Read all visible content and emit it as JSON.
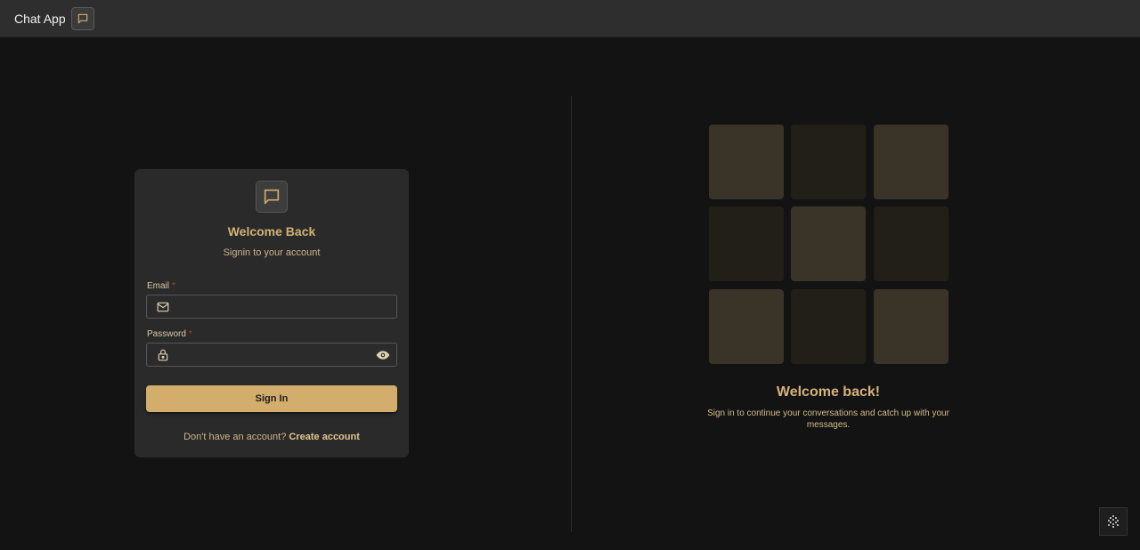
{
  "header": {
    "app_title": "Chat App",
    "icon": "chat-bubble-icon"
  },
  "login": {
    "title": "Welcome Back",
    "subtitle": "Signin to your account",
    "email_label": "Email",
    "email_value": "",
    "email_required": "*",
    "password_label": "Password",
    "password_value": "",
    "password_required": "*",
    "signin_label": "Sign In",
    "signup_prompt": "Don't have an account?",
    "signup_link": "Create account"
  },
  "hero": {
    "title": "Welcome back!",
    "subtitle": "Sign in to continue your conversations and catch up with your messages.",
    "tiles": [
      "light",
      "dark",
      "light",
      "dark",
      "light",
      "dark",
      "light",
      "dark",
      "light"
    ]
  },
  "colors": {
    "accent": "#d2ad6c",
    "background": "#131313",
    "card": "#2a2a2a",
    "required": "#c0392b"
  },
  "icons": {
    "email": "mail-icon",
    "password": "lock-icon",
    "reveal": "eye-icon",
    "card": "chat-bubble-icon"
  }
}
